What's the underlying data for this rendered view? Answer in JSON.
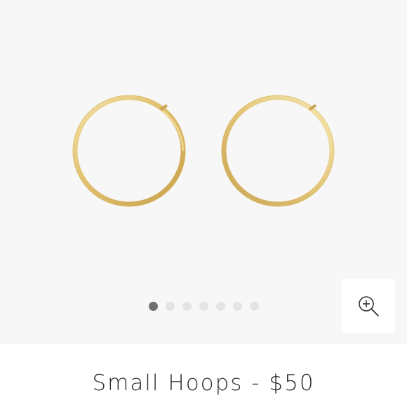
{
  "product": {
    "name": "Small Hoops",
    "separator": "-",
    "price": "$50"
  },
  "gallery": {
    "slide_count": 7,
    "active_index": 0,
    "image_subject": "pair of gold hoop earrings",
    "metal_color": "#e6c97a"
  },
  "zoom": {
    "icon": "zoom-in-icon"
  },
  "colors": {
    "gallery_background": "#f7f7f7",
    "dot_active": "#707070",
    "dot_inactive": "#e4e4e4",
    "title_text": "#2b2b2b"
  }
}
